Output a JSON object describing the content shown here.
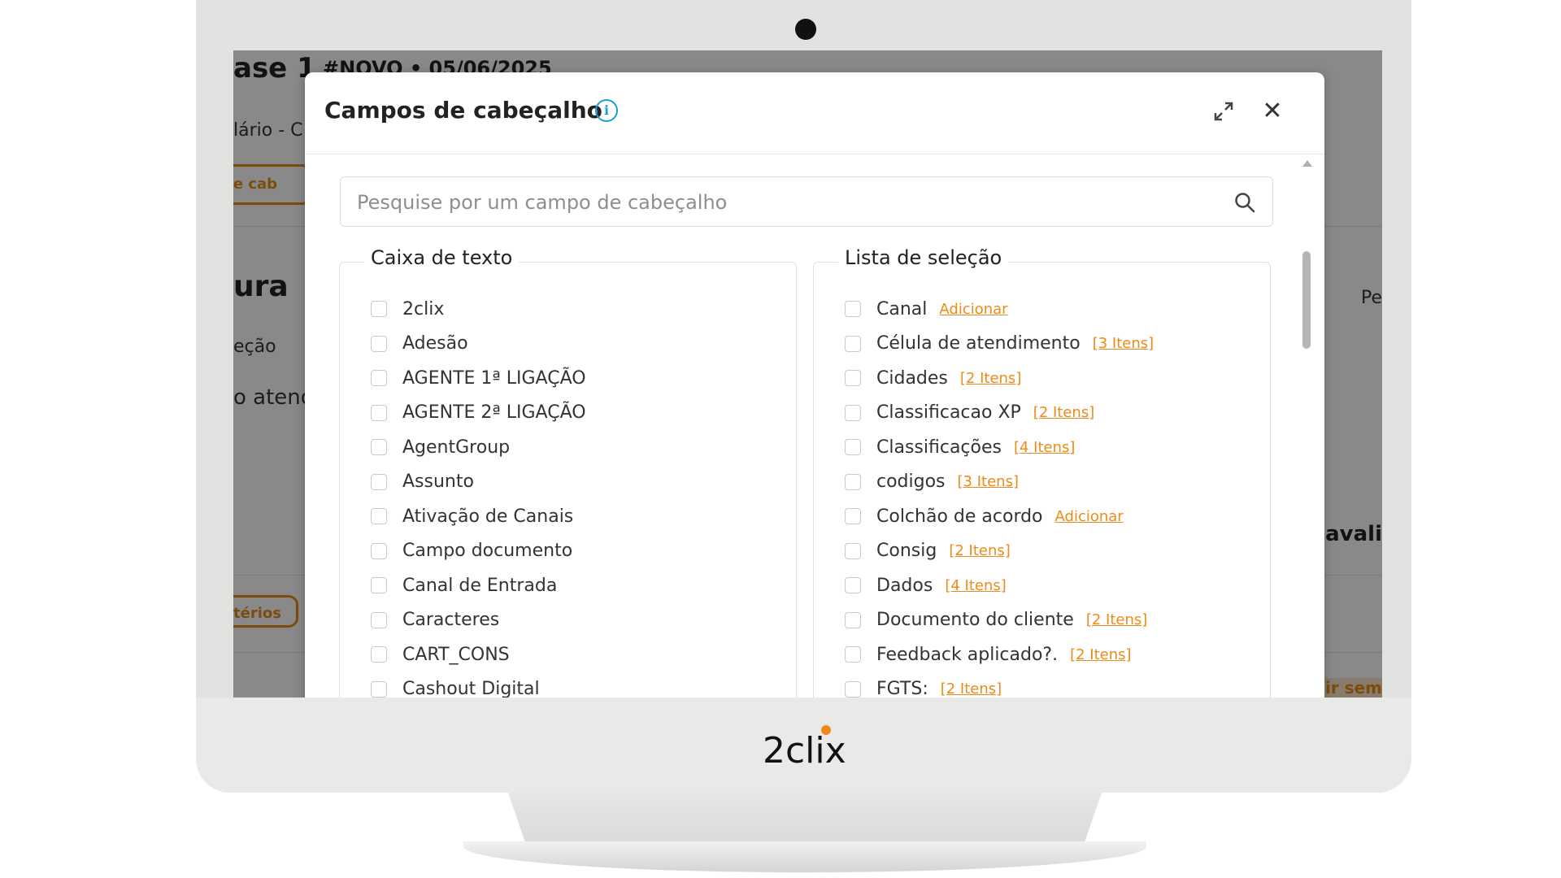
{
  "background_app": {
    "title": "ase 1",
    "meta": "#NOVO • 05/06/2025",
    "subtitle": "lário - C",
    "tab_label": "s de cab",
    "section_title": "ura",
    "section_sub": "eção",
    "row_text": "o atend",
    "pill_label": "itérios",
    "right_text_1": "Pe",
    "right_text_2": "avali",
    "right_text_3": "ir sem"
  },
  "modal": {
    "title": "Campos de cabeçalho",
    "info_icon": "info-icon",
    "expand_icon": "expand-icon",
    "close_icon": "close-icon",
    "search": {
      "placeholder": "Pesquise por um campo de cabeçalho",
      "value": ""
    },
    "groups": {
      "text_fields": {
        "title": "Caixa de texto",
        "items": [
          "2clix",
          "Adesão",
          "AGENTE 1ª LIGAÇÃO",
          "AGENTE 2ª LIGAÇÃO",
          "AgentGroup",
          "Assunto",
          "Ativação de Canais",
          "Campo documento",
          "Canal de Entrada",
          "Caracteres",
          "CART_CONS",
          "Cashout Digital"
        ]
      },
      "select_fields": {
        "title": "Lista de seleção",
        "items": [
          {
            "label": "Canal",
            "badge": "Adicionar"
          },
          {
            "label": "Célula de atendimento",
            "badge": "[3 Itens]"
          },
          {
            "label": "Cidades",
            "badge": "[2 Itens]"
          },
          {
            "label": "Classificacao XP",
            "badge": "[2 Itens]"
          },
          {
            "label": "Classificações",
            "badge": "[4 Itens]"
          },
          {
            "label": "codigos",
            "badge": "[3 Itens]"
          },
          {
            "label": "Colchão de acordo",
            "badge": "Adicionar"
          },
          {
            "label": "Consig",
            "badge": "[2 Itens]"
          },
          {
            "label": "Dados",
            "badge": "[4 Itens]"
          },
          {
            "label": "Documento do cliente",
            "badge": "[2 Itens]"
          },
          {
            "label": "Feedback aplicado?.",
            "badge": "[2 Itens]"
          },
          {
            "label": "FGTS:",
            "badge": "[2 Itens]"
          }
        ]
      }
    }
  },
  "device": {
    "brand_logo": "2clix",
    "accent": "#ee8a18",
    "info_color": "#1e9bd7"
  }
}
